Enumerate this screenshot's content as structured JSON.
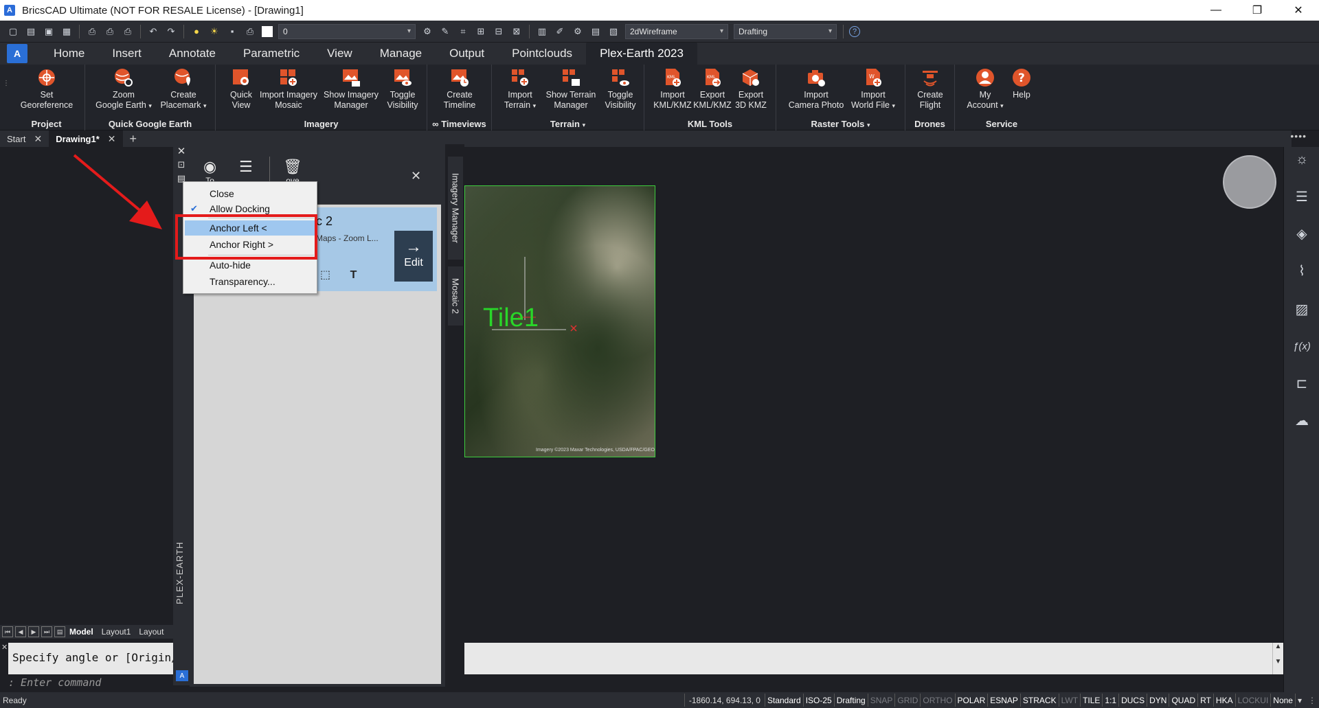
{
  "window": {
    "title": "BricsCAD Ultimate (NOT FOR RESALE License) - [Drawing1]",
    "minimize": "—",
    "restore": "❐",
    "close": "✕"
  },
  "qat": {
    "layer_value": "0",
    "visual_style": "2dWireframe",
    "workspace": "Drafting",
    "help": "?"
  },
  "ribbon_tabs": [
    "Home",
    "Insert",
    "Annotate",
    "Parametric",
    "View",
    "Manage",
    "Output",
    "Pointclouds",
    "Plex-Earth 2023"
  ],
  "active_tab_index": 8,
  "ribbon": {
    "project": {
      "title": "Project",
      "set_georeference": [
        "Set",
        "Georeference"
      ]
    },
    "quick_ge": {
      "title": "Quick Google Earth",
      "zoom": [
        "Zoom",
        "Google Earth"
      ],
      "placemark": [
        "Create",
        "Placemark"
      ]
    },
    "imagery": {
      "title": "Imagery",
      "quick_view": [
        "Quick",
        "View"
      ],
      "import_mosaic": [
        "Import Imagery",
        "Mosaic"
      ],
      "show_manager": [
        "Show Imagery",
        "Manager"
      ],
      "toggle_visibility": [
        "Toggle",
        "Visibility"
      ]
    },
    "timeviews": {
      "title": "Timeviews",
      "create_timeline": [
        "Create",
        "Timeline"
      ]
    },
    "terrain": {
      "title": "Terrain",
      "import_terrain": [
        "Import",
        "Terrain"
      ],
      "show_terrain_manager": [
        "Show Terrain",
        "Manager"
      ],
      "toggle_visibility": [
        "Toggle",
        "Visibility"
      ]
    },
    "kml": {
      "title": "KML Tools",
      "import_kml": [
        "Import",
        "KML/KMZ"
      ],
      "export_kml": [
        "Export",
        "KML/KMZ"
      ],
      "export_3d": [
        "Export",
        "3D KMZ"
      ]
    },
    "raster": {
      "title": "Raster Tools",
      "import_camera": [
        "Import",
        "Camera Photo"
      ],
      "import_world": [
        "Import",
        "World File"
      ]
    },
    "drones": {
      "title": "Drones",
      "create_flight": [
        "Create",
        "Flight"
      ]
    },
    "service": {
      "title": "Service",
      "my_account": [
        "My",
        "Account"
      ],
      "help": [
        "Help"
      ]
    }
  },
  "doc_tabs": {
    "start": "Start",
    "drawing": "Drawing1*",
    "close": "✕",
    "new": "+"
  },
  "canvas": {
    "tile_label": "Tile1",
    "imagery_credit": "Imagery ©2023 Maxar Technologies, USDA/FPAC/GEO"
  },
  "imagery_manager": {
    "tool_eye_label": "To",
    "tool_remove_label": "ove",
    "mosaic_name": "c 2",
    "mosaic_sub": "Maps - Zoom L...",
    "edit_label": "Edit",
    "vtab_imagery": "Imagery Manager",
    "vtab_mosaic": "Mosaic 2",
    "panel_label": "PLEX-EARTH"
  },
  "context_menu": {
    "items": [
      "Close",
      "Allow Docking",
      "Anchor Left <",
      "Anchor Right >",
      "Auto-hide",
      "Transparency..."
    ],
    "checked_index": 1,
    "highlighted_index": 2
  },
  "layout_tabs": [
    "Model",
    "Layout1",
    "Layout"
  ],
  "command": {
    "history": "Specify angle or [Origin/C",
    "prompt": ": Enter command"
  },
  "status": {
    "ready": "Ready",
    "coords": "-1860.14, 694.13, 0",
    "items": [
      {
        "label": "Standard",
        "state": "on"
      },
      {
        "label": "ISO-25",
        "state": "on"
      },
      {
        "label": "Drafting",
        "state": "on"
      },
      {
        "label": "SNAP",
        "state": "off"
      },
      {
        "label": "GRID",
        "state": "off"
      },
      {
        "label": "ORTHO",
        "state": "off"
      },
      {
        "label": "POLAR",
        "state": "on"
      },
      {
        "label": "ESNAP",
        "state": "on"
      },
      {
        "label": "STRACK",
        "state": "on"
      },
      {
        "label": "LWT",
        "state": "off"
      },
      {
        "label": "TILE",
        "state": "on"
      },
      {
        "label": "1:1",
        "state": "on"
      },
      {
        "label": "DUCS",
        "state": "on"
      },
      {
        "label": "DYN",
        "state": "on"
      },
      {
        "label": "QUAD",
        "state": "on"
      },
      {
        "label": "RT",
        "state": "on"
      },
      {
        "label": "HKA",
        "state": "on"
      },
      {
        "label": "LOCKUI",
        "state": "off"
      },
      {
        "label": "None",
        "state": "on"
      }
    ]
  },
  "colors": {
    "accent": "#e0552b",
    "annotation_red": "#e41b1b",
    "tile_green": "#29d629",
    "menu_highlight": "#9fc7ef"
  }
}
